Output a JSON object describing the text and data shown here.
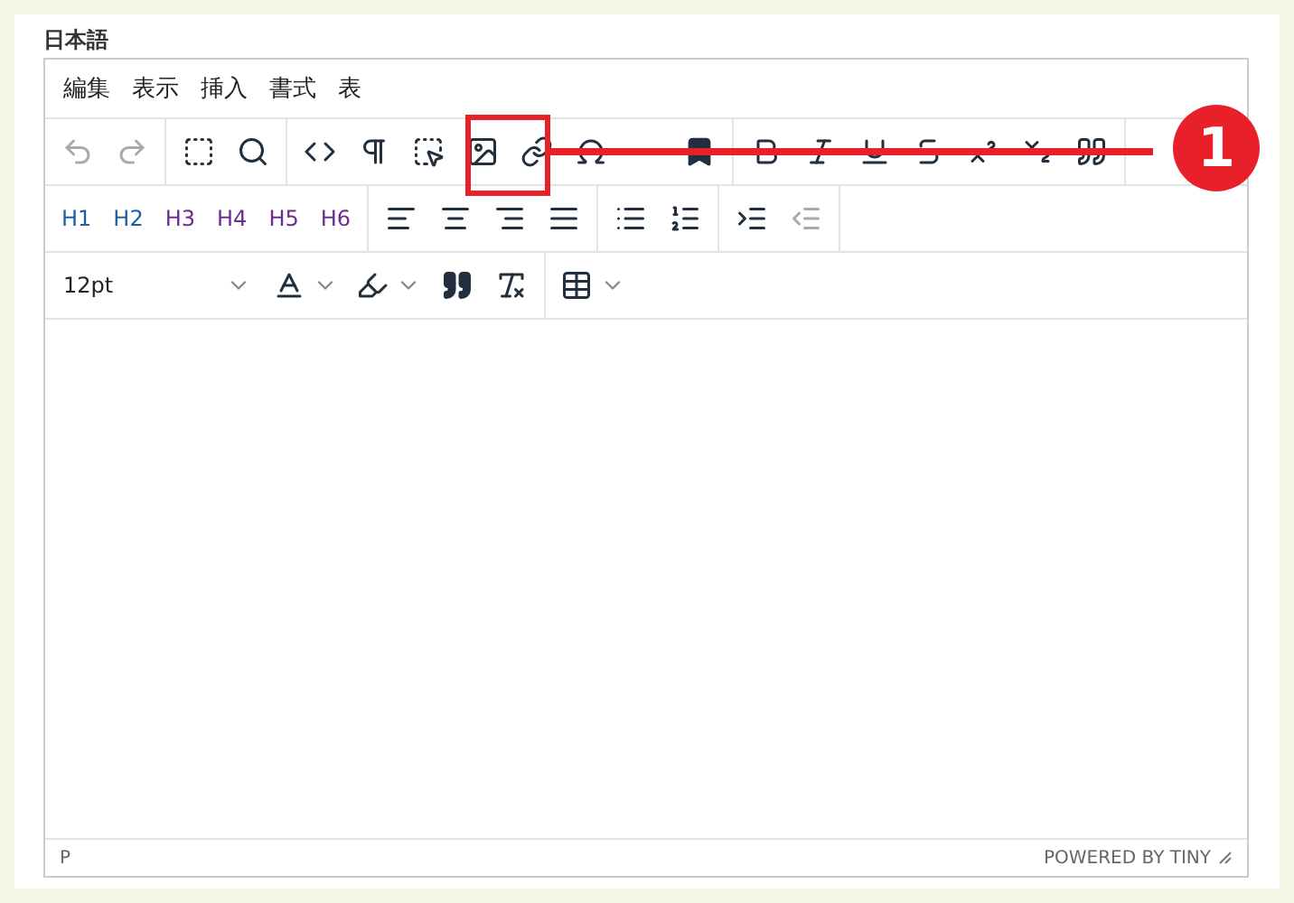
{
  "label": "日本語",
  "menu": [
    "編集",
    "表示",
    "挿入",
    "書式",
    "表"
  ],
  "toolbar_1": [
    [
      {
        "kind": "undo",
        "disabled": true
      },
      {
        "kind": "redo",
        "disabled": true
      }
    ],
    [
      {
        "kind": "select-all",
        "disabled": false
      },
      {
        "kind": "search",
        "disabled": false
      }
    ],
    [
      {
        "kind": "code",
        "disabled": false
      },
      {
        "kind": "pilcrow",
        "disabled": false
      },
      {
        "kind": "blocks",
        "disabled": false
      },
      {
        "kind": "image",
        "disabled": false
      },
      {
        "kind": "link",
        "disabled": false
      },
      {
        "kind": "omega",
        "disabled": false
      },
      {
        "kind": "bookmark",
        "disabled": false
      }
    ],
    [
      {
        "kind": "bold",
        "disabled": false
      },
      {
        "kind": "italic",
        "disabled": false
      },
      {
        "kind": "underline",
        "disabled": false
      },
      {
        "kind": "strike",
        "disabled": false
      },
      {
        "kind": "superscript",
        "disabled": false
      },
      {
        "kind": "subscript",
        "disabled": false
      },
      {
        "kind": "quote",
        "disabled": false
      }
    ]
  ],
  "headings": [
    {
      "label": "H1",
      "color": "#1f5fa8"
    },
    {
      "label": "H2",
      "color": "#1f5fa8"
    },
    {
      "label": "H3",
      "color": "#6b2d8f"
    },
    {
      "label": "H4",
      "color": "#6b2d8f"
    },
    {
      "label": "H5",
      "color": "#6b2d8f"
    },
    {
      "label": "H6",
      "color": "#6b2d8f"
    }
  ],
  "toolbar_2": [
    [
      {
        "kind": "align-left",
        "disabled": false
      },
      {
        "kind": "align-center",
        "disabled": false
      },
      {
        "kind": "align-right",
        "disabled": false
      },
      {
        "kind": "justify",
        "disabled": false
      }
    ],
    [
      {
        "kind": "bullet-list",
        "disabled": false
      },
      {
        "kind": "number-list",
        "disabled": false
      }
    ],
    [
      {
        "kind": "indent",
        "disabled": false
      },
      {
        "kind": "outdent",
        "disabled": true
      }
    ]
  ],
  "font_size": "12pt",
  "status_path": "P",
  "branding": "POWERED BY TINY",
  "callout": "1"
}
